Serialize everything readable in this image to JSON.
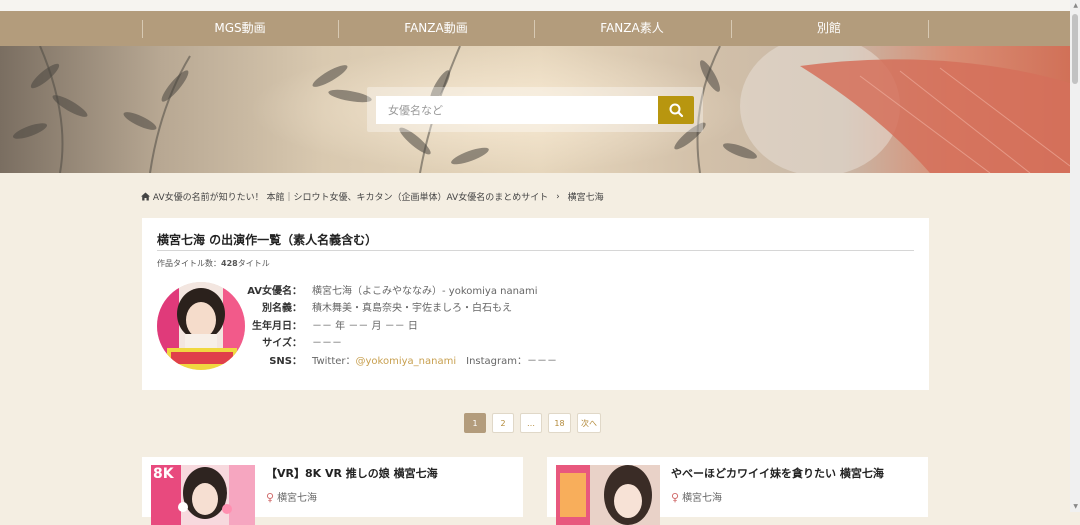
{
  "nav": {
    "items": [
      {
        "label": "MGS動画"
      },
      {
        "label": "FANZA動画"
      },
      {
        "label": "FANZA素人"
      },
      {
        "label": "別館"
      }
    ]
  },
  "search": {
    "placeholder": "女優名など",
    "button_icon": "search-icon",
    "button_color": "#b8960f"
  },
  "breadcrumb": {
    "home_icon": "home-icon",
    "home_label": "AV女優の名前が知りたい！ 本館｜シロウト女優、キカタン（企画単体）AV女優名のまとめサイト",
    "separator": "›",
    "current": "横宮七海"
  },
  "profile": {
    "title": "横宮七海 の出演作一覧（素人名義含む）",
    "count_prefix": "作品タイトル数：",
    "count_value": "428",
    "count_suffix": "タイトル",
    "rows": [
      {
        "label": "AV女優名：",
        "value": "横宮七海（よこみやななみ）- yokomiya nanami"
      },
      {
        "label": "別名義：",
        "value": "積木舞美・真島奈央・宇佐ましろ・白石もえ"
      },
      {
        "label": "生年月日：",
        "value": "－－ 年 －－ 月 －－ 日"
      },
      {
        "label": "サイズ：",
        "value": "－－－"
      }
    ],
    "sns": {
      "label": "SNS：",
      "twitter_prefix": "Twitter：",
      "twitter_handle": "@yokomiya_nanami",
      "instagram": "Instagram：－－－"
    }
  },
  "pagination": {
    "pages": [
      "1",
      "2",
      "…",
      "18"
    ],
    "next_label": "次へ",
    "active": "1"
  },
  "products": [
    {
      "title": "【VR】8K VR 推しの娘 横宮七海",
      "actress": "横宮七海",
      "thumb_badge": "8K"
    },
    {
      "title": "やべーほどカワイイ妹を貪りたい 横宮七海",
      "actress": "横宮七海",
      "thumb_badge": ""
    }
  ],
  "colors": {
    "nav_bg": "#b39c7c",
    "page_bg": "#f4eee2",
    "accent_gold": "#b8960f",
    "link": "#c8a050"
  }
}
